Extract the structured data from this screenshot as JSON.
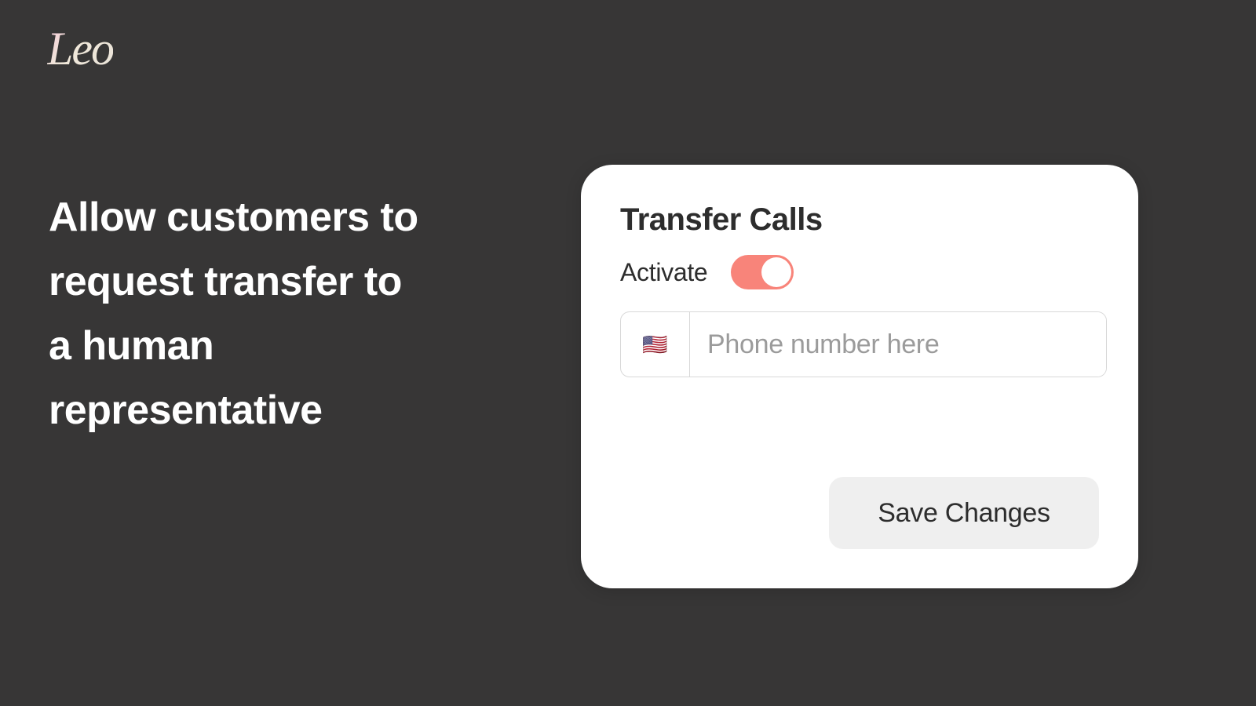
{
  "brand": {
    "logo_text": "Leo"
  },
  "hero": {
    "tagline": "Allow customers to request transfer to a human representative"
  },
  "card": {
    "title": "Transfer Calls",
    "activate_label": "Activate",
    "toggle_on": true,
    "phone": {
      "country_flag": "🇺🇸",
      "placeholder": "Phone number here",
      "value": ""
    },
    "save_label": "Save Changes"
  },
  "colors": {
    "background": "#373636",
    "accent": "#F8847A",
    "text_light": "#FFFFFF",
    "text_dark": "#2D2D2D",
    "border": "#D8D8D8",
    "button_bg": "#EFEFEF",
    "placeholder": "#9B9B9B"
  }
}
